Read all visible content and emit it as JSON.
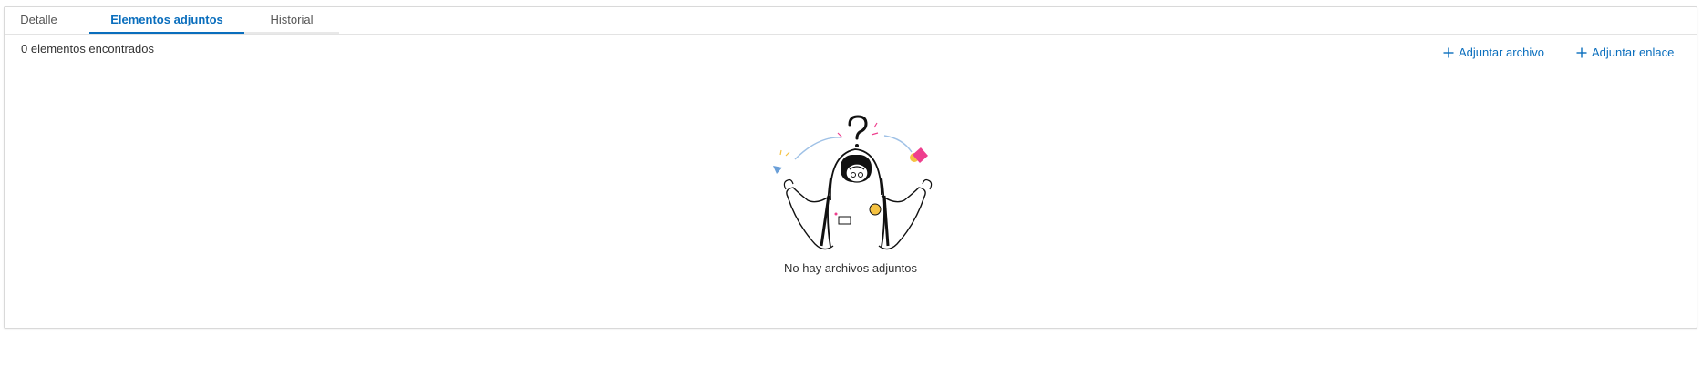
{
  "tabs": [
    {
      "label": "Detalle"
    },
    {
      "label": "Elementos adjuntos"
    },
    {
      "label": "Historial"
    }
  ],
  "active_tab": "Elementos adjuntos",
  "results": {
    "count_text": "0 elementos encontrados"
  },
  "actions": {
    "attach_file": {
      "label": "Adjuntar archivo",
      "icon": "plus-icon"
    },
    "attach_link": {
      "label": "Adjuntar enlace",
      "icon": "plus-icon"
    }
  },
  "empty_state": {
    "message": "No hay archivos adjuntos",
    "illustration": "confused-astronaut-illustration"
  },
  "colors": {
    "accent": "#0a6ebd",
    "text": "#333333",
    "tab_inactive": "#555555",
    "border": "#d9d9d9",
    "illustration_pink": "#ee3f8e",
    "illustration_yellow": "#f5c242",
    "illustration_blue": "#6a9fd8"
  }
}
